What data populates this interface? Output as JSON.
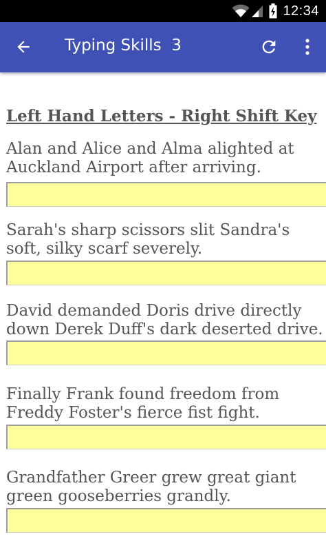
{
  "status_bar": {
    "time": "12:34",
    "icons": [
      "wifi-icon",
      "cell-signal-icon",
      "battery-charging-icon"
    ]
  },
  "app_bar": {
    "title": "Typing Skills  3",
    "icons": [
      "arrow-back-icon",
      "refresh-icon",
      "more-vert-icon"
    ],
    "color": "#3f51b5"
  },
  "content": {
    "heading": "Left Hand Letters - Right Shift Key",
    "exercises": [
      {
        "text": " Alan and Alice and Alma alighted at Auckland Airport after arriving.",
        "input_value": ""
      },
      {
        "text": " Sarah's sharp scissors slit Sandra's soft, silky scarf severely.",
        "input_value": ""
      },
      {
        "text": " David demanded Doris drive directly down Derek Duff's dark deserted drive.",
        "input_value": ""
      },
      {
        "text": " Finally Frank found freedom from Freddy Foster's fierce fist fight.",
        "input_value": ""
      },
      {
        "text": " Grandfather Greer grew great giant green gooseberries grandly.",
        "input_value": ""
      }
    ],
    "input_color": "#ffff99"
  }
}
